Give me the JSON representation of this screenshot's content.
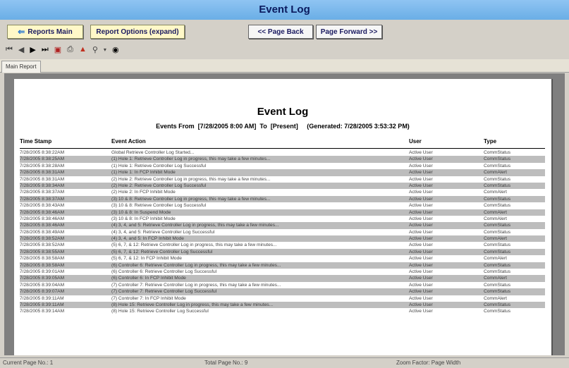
{
  "window": {
    "title": "Event Log"
  },
  "buttons": {
    "reports_main": "Reports Main",
    "report_options": "Report Options (expand)",
    "page_back": "<< Page Back",
    "page_forward": "Page Forward >>"
  },
  "toolbar_icons": [
    "first-page-icon",
    "prev-page-icon",
    "next-page-icon",
    "last-page-icon",
    "export-icon",
    "print-icon",
    "pdf-icon",
    "zoom-icon",
    "dropdown-icon",
    "find-icon"
  ],
  "tab": {
    "label": "Main Report"
  },
  "report": {
    "title": "Event Log",
    "subtitle": "Events From  [7/28/2005 8:00 AM]  To  [Present]     (Generated: 7/28/2005 3:53:32 PM)",
    "columns": [
      "Time Stamp",
      "Event Action",
      "User",
      "Type"
    ],
    "rows": [
      [
        "7/28/2005  8:38:22AM",
        "Global Retrieve Controller Log Started...",
        "Active User",
        "CommStatus"
      ],
      [
        "7/28/2005  8:38:25AM",
        "(1) Hole 1: Retrieve Controller Log in progress, this may take a few minutes...",
        "Active User",
        "CommStatus"
      ],
      [
        "7/28/2005  8:38:28AM",
        "(1) Hole 1: Retrieve Controller Log Successful",
        "Active User",
        "CommStatus"
      ],
      [
        "7/28/2005  8:38:31AM",
        "(1) Hole 1: In FCP Inhibit Mode",
        "Active User",
        "CommAlert"
      ],
      [
        "7/28/2005  8:38:31AM",
        "(2) Hole 2: Retrieve Controller Log in progress, this may take a few minutes...",
        "Active User",
        "CommStatus"
      ],
      [
        "7/28/2005  8:38:34AM",
        "(2) Hole 2: Retrieve Controller Log Successful",
        "Active User",
        "CommStatus"
      ],
      [
        "7/28/2005  8:38:37AM",
        "(2) Hole 2: In FCP Inhibit Mode",
        "Active User",
        "CommAlert"
      ],
      [
        "7/28/2005  8:38:37AM",
        "(3) 10 & 8: Retrieve Controller Log in progress, this may take a few minutes...",
        "Active User",
        "CommStatus"
      ],
      [
        "7/28/2005  8:38:43AM",
        "(3) 10 & 8: Retrieve Controller Log Successful",
        "Active User",
        "CommStatus"
      ],
      [
        "7/28/2005  8:38:46AM",
        "(3) 10 & 8: In Suspend Mode",
        "Active User",
        "CommAlert"
      ],
      [
        "7/28/2005  8:38:46AM",
        "(3) 10 & 8: In FCP Inhibit Mode",
        "Active User",
        "CommAlert"
      ],
      [
        "7/28/2005  8:38:46AM",
        "(4) 3, 4, and 5: Retrieve Controller Log in progress, this may take a few minutes...",
        "Active User",
        "CommStatus"
      ],
      [
        "7/28/2005  8:38:49AM",
        "(4) 3, 4, and 5: Retrieve Controller Log Successful",
        "Active User",
        "CommStatus"
      ],
      [
        "7/28/2005  8:38:52AM",
        "(4) 3, 4, and 5: In FCP Inhibit Mode",
        "Active User",
        "CommAlert"
      ],
      [
        "7/28/2005  8:38:52AM",
        "(5) 6, 7, & 12: Retrieve Controller Log in progress, this may take a few minutes...",
        "Active User",
        "CommStatus"
      ],
      [
        "7/28/2005  8:38:55AM",
        "(5) 6, 7, & 12: Retrieve Controller Log Successful",
        "Active User",
        "CommStatus"
      ],
      [
        "7/28/2005  8:38:58AM",
        "(5) 6, 7, & 12: In FCP Inhibit Mode",
        "Active User",
        "CommAlert"
      ],
      [
        "7/28/2005  8:38:58AM",
        "(6) Controller 6: Retrieve Controller Log in progress, this may take a few minutes...",
        "Active User",
        "CommStatus"
      ],
      [
        "7/28/2005  8:39:01AM",
        "(6) Controller 6: Retrieve Controller Log Successful",
        "Active User",
        "CommStatus"
      ],
      [
        "7/28/2005  8:39:05AM",
        "(6) Controller 6: In FCP Inhibit Mode",
        "Active User",
        "CommAlert"
      ],
      [
        "7/28/2005  8:39:04AM",
        "(7) Controller 7: Retrieve Controller Log in progress, this may take a few minutes...",
        "Active User",
        "CommStatus"
      ],
      [
        "7/28/2005  8:39:07AM",
        "(7) Controller 7: Retrieve Controller Log Successful",
        "Active User",
        "CommStatus"
      ],
      [
        "7/28/2005  8:39:11AM",
        "(7) Controller 7: In FCP Inhibit Mode",
        "Active User",
        "CommAlert"
      ],
      [
        "7/28/2005  8:39:11AM",
        "(8) Hole 15: Retrieve Controller Log in progress, this may take a few minutes...",
        "Active User",
        "CommStatus"
      ],
      [
        "7/28/2005  8:39:14AM",
        "(8) Hole 15: Retrieve Controller Log Successful",
        "Active User",
        "CommStatus"
      ]
    ]
  },
  "status": {
    "current_page": "Current Page No.: 1",
    "total_page": "Total Page No.: 9",
    "zoom": "Zoom Factor: Page Width"
  }
}
